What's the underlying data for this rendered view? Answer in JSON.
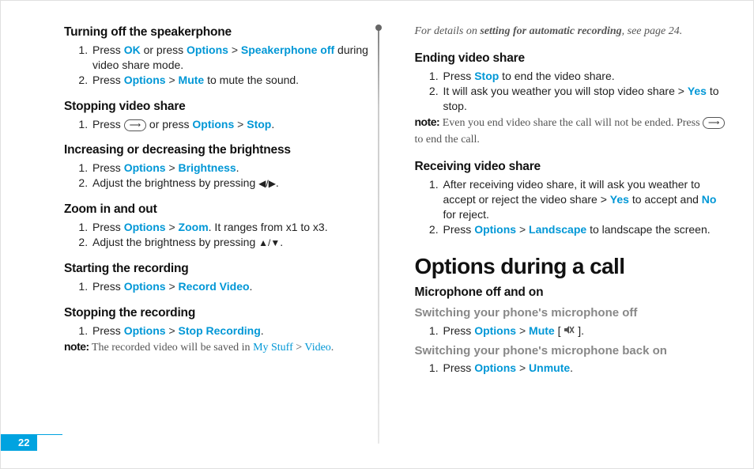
{
  "page_number": "22",
  "left": {
    "s1": {
      "h": "Turning off the speakerphone",
      "i1a": "Press ",
      "i1_ok": "OK",
      "i1b": " or press ",
      "i1_opt": "Options",
      "i1c": " > ",
      "i1_spk": "Speakerphone off",
      "i1d": " during video share mode.",
      "i2a": "Press ",
      "i2_opt": "Options",
      "i2b": " > ",
      "i2_mute": "Mute",
      "i2c": " to mute the sound."
    },
    "s2": {
      "h": "Stopping video share",
      "i1a": "Press ",
      "i1b": " or press ",
      "i1_opt": "Options",
      "i1c": " > ",
      "i1_stop": "Stop",
      "i1d": "."
    },
    "s3": {
      "h": "Increasing or decreasing the brightness",
      "i1a": "Press ",
      "i1_opt": "Options",
      "i1b": " > ",
      "i1_br": "Brightness",
      "i1c": ".",
      "i2a": "Adjust the brightness by pressing ",
      "i2_arr": "◀/▶",
      "i2b": "."
    },
    "s4": {
      "h": "Zoom in and out",
      "i1a": "Press ",
      "i1_opt": "Options",
      "i1b": " > ",
      "i1_z": "Zoom",
      "i1c": ". It ranges from x1 to x3.",
      "i2a": "Adjust the brightness by pressing ",
      "i2_arr": "▲/▼",
      "i2b": "."
    },
    "s5": {
      "h": "Starting the recording",
      "i1a": "Press ",
      "i1_opt": "Options",
      "i1b": " > ",
      "i1_rv": "Record Video",
      "i1c": "."
    },
    "s6": {
      "h": "Stopping the recording",
      "i1a": "Press ",
      "i1_opt": "Options",
      "i1b": " > ",
      "i1_sr": "Stop Recording",
      "i1c": ".",
      "note_lbl": "note:",
      "note_a": " The recorded video will be saved in ",
      "note_my": "My Stuff",
      "note_b": " > ",
      "note_vid": "Video",
      "note_c": "."
    }
  },
  "right": {
    "top_ital_a": "For details on ",
    "top_ital_b": "setting for automatic recording",
    "top_ital_c": ", see page 24.",
    "s7": {
      "h": "Ending video share",
      "i1a": "Press ",
      "i1_stop": "Stop",
      "i1b": " to end the video share.",
      "i2a": "It will ask you weather you will stop video share > ",
      "i2_yes": "Yes",
      "i2b": " to stop.",
      "note_lbl": "note:",
      "note_a": " Even you end video share the call will not be ended. Press ",
      "note_b": " to end the call."
    },
    "s8": {
      "h": "Receiving video share",
      "i1a": "After receiving video share, it will ask you weather to accept or reject the video share > ",
      "i1_yes": "Yes",
      "i1b": " to accept and ",
      "i1_no": "No",
      "i1c": " for reject.",
      "i2a": "Press ",
      "i2_opt": "Options",
      "i2b": " > ",
      "i2_land": "Landscape",
      "i2c": " to landscape the screen."
    },
    "h1": "Options during a call",
    "s9h": "Microphone off and on",
    "s10": {
      "sub": "Switching your phone's microphone off",
      "i1a": "Press ",
      "i1_opt": "Options",
      "i1b": " > ",
      "i1_mute": "Mute",
      "i1c": " [ ",
      "i1d": " ]."
    },
    "s11": {
      "sub": "Switching your phone's microphone back on",
      "i1a": "Press ",
      "i1_opt": "Options",
      "i1b": " > ",
      "i1_un": "Unmute",
      "i1c": "."
    }
  }
}
